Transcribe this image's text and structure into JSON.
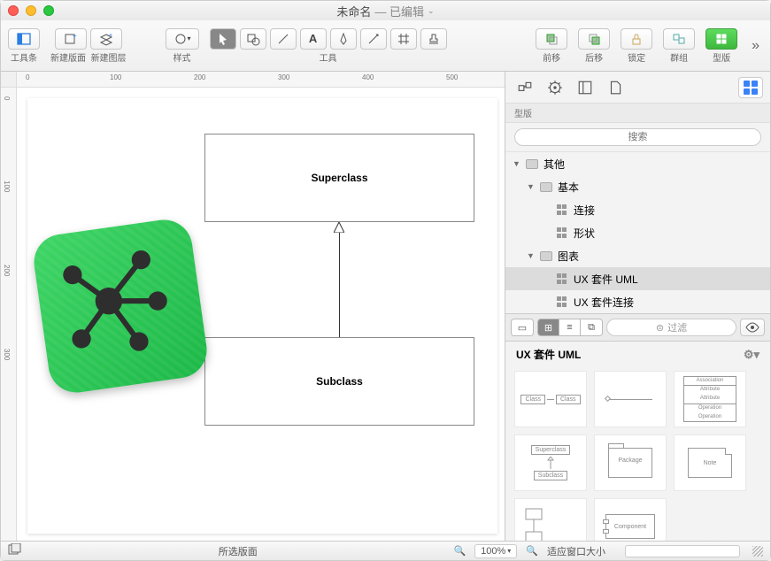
{
  "window": {
    "title": "未命名",
    "edited": "— 已编辑"
  },
  "toolbar": {
    "toolbar_label": "工具条",
    "new_canvas_label": "新建版面",
    "new_layer_label": "新建图层",
    "style_label": "样式",
    "tools_label": "工具",
    "forward_label": "前移",
    "backward_label": "后移",
    "lock_label": "锁定",
    "group_label": "群组",
    "stencils_label": "型版"
  },
  "canvas": {
    "superclass": "Superclass",
    "subclass": "Subclass",
    "ruler_marks": [
      "0",
      "100",
      "200",
      "300",
      "400",
      "500"
    ],
    "ruler_v_marks": [
      "0",
      "100",
      "200",
      "300"
    ]
  },
  "inspector": {
    "section": "型版",
    "search_placeholder": "搜索",
    "tree": {
      "misc": "其他",
      "basic": "基本",
      "connections": "连接",
      "shapes": "形状",
      "diagrams": "图表",
      "ux_uml": "UX 套件 UML",
      "ux_conn": "UX 套件连接"
    },
    "filter_label": "过滤",
    "stencil_title": "UX 套件 UML",
    "shapes": {
      "class": "Class",
      "association": "Association",
      "attribute": "Attribute",
      "operation": "Operation",
      "superclass": "Superclass",
      "subclass": "Subclass",
      "package": "Package",
      "note": "Note",
      "component": "Component"
    }
  },
  "statusbar": {
    "canvas_label": "所选版面",
    "zoom": "100%",
    "fit": "适应窗口大小"
  }
}
